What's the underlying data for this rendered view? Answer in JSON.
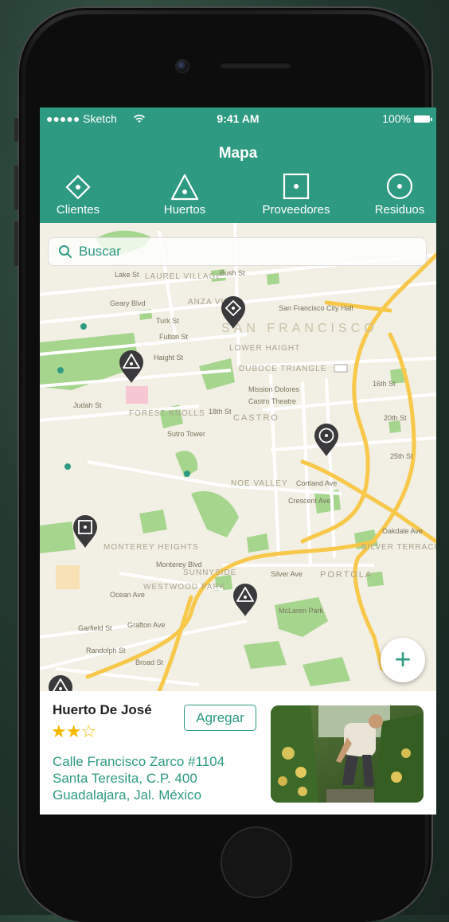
{
  "status_bar": {
    "carrier": "●●●●● Sketch",
    "time": "9:41 AM",
    "battery": "100%"
  },
  "header": {
    "title": "Mapa"
  },
  "tabs": [
    {
      "label": "Clientes",
      "icon": "diamond-icon"
    },
    {
      "label": "Huertos",
      "icon": "triangle-icon"
    },
    {
      "label": "Proveedores",
      "icon": "square-dot-icon"
    },
    {
      "label": "Residuos",
      "icon": "circle-dot-icon"
    }
  ],
  "search": {
    "placeholder": "Buscar",
    "icon": "search-icon"
  },
  "map": {
    "labels": {
      "sf": "SAN FRANCISCO",
      "lake": "Lake St",
      "geary": "Geary Blvd",
      "turk": "Turk St",
      "fulton": "Fulton St",
      "haight": "Haight St",
      "judah": "Judah St",
      "castro": "CASTRO",
      "forest": "FOREST KNOLLS",
      "monterey": "MONTEREY HEIGHTS",
      "westwood": "WESTWOOD PARK",
      "portola": "PORTOLA",
      "mclaren": "McLaren Park",
      "silver": "SILVER TERRACE",
      "mission": "Mission Dolores",
      "sutro": "Sutro Tower",
      "lower": "LOWER HAIGHT",
      "duboce": "DUBOCE TRIANGLE",
      "noe": "NOE VALLEY",
      "anza": "ANZA VISTA",
      "laurel": "LAUREL VILLAGE",
      "bush": "Bush St",
      "st16": "16th St",
      "st20": "20th St",
      "st25": "25th St",
      "oakdale": "Oakdale Ave",
      "silverave": "Silver Ave",
      "garfield": "Garfield St",
      "grafton": "Grafton Ave",
      "randolph": "Randolph St",
      "broad": "Broad St",
      "montereyblvd": "Monterey Blvd",
      "ocean": "Ocean Ave",
      "crescent": "Crescent Ave",
      "cortland": "Cortland Ave",
      "sunnyside": "SUNNYSIDE",
      "castrotheatre": "Castro Theatre",
      "st18": "18th St",
      "cityhall": "San Francisco City Hall"
    }
  },
  "fab": {
    "label": "+",
    "icon": "plus-icon"
  },
  "card": {
    "name": "Huerto De José",
    "rating": 2,
    "rating_max": 3,
    "add_label": "Agregar",
    "address_line1": "Calle Francisco Zarco #1104",
    "address_line2": "Santa Teresita, C.P. 400",
    "address_line3": "Guadalajara, Jal. México",
    "photo_icon": "farmer-photo"
  },
  "colors": {
    "accent": "#2e9a82",
    "star": "#f5b800",
    "map_bg": "#f2efe4",
    "highway": "#f7c84a",
    "park": "#a6d58e",
    "pin": "#3a3a3c"
  }
}
